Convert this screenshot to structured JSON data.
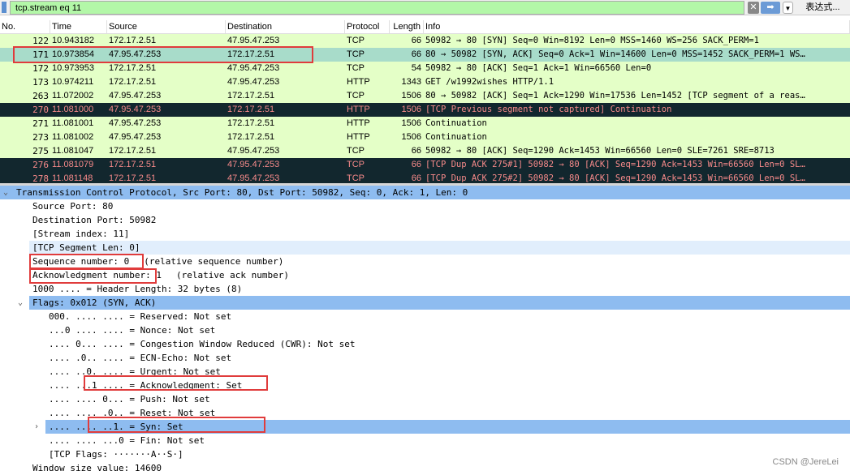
{
  "filter": {
    "value": "tcp.stream eq 11",
    "clear_icon": "x-icon",
    "apply_icon": "arrow-right-icon",
    "expression_label": "表达式..."
  },
  "columns": [
    "No.",
    "Time",
    "Source",
    "Destination",
    "Protocol",
    "Length",
    "Info"
  ],
  "packets": [
    {
      "no": "122",
      "time": "10.943182",
      "src": "172.17.2.51",
      "dst": "47.95.47.253",
      "proto": "TCP",
      "len": "66",
      "info": "50982 → 80 [SYN] Seq=0 Win=8192 Len=0 MSS=1460 WS=256 SACK_PERM=1",
      "style": "g"
    },
    {
      "no": "171",
      "time": "10.973854",
      "src": "47.95.47.253",
      "dst": "172.17.2.51",
      "proto": "TCP",
      "len": "66",
      "info": "80 → 50982 [SYN, ACK] Seq=0 Ack=1 Win=14600 Len=0 MSS=1452 SACK_PERM=1 WS…",
      "style": "sel"
    },
    {
      "no": "172",
      "time": "10.973953",
      "src": "172.17.2.51",
      "dst": "47.95.47.253",
      "proto": "TCP",
      "len": "54",
      "info": "50982 → 80 [ACK] Seq=1 Ack=1 Win=66560 Len=0",
      "style": "g"
    },
    {
      "no": "173",
      "time": "10.974211",
      "src": "172.17.2.51",
      "dst": "47.95.47.253",
      "proto": "HTTP",
      "len": "1343",
      "info": "GET /w1992wishes HTTP/1.1",
      "style": "g"
    },
    {
      "no": "263",
      "time": "11.072002",
      "src": "47.95.47.253",
      "dst": "172.17.2.51",
      "proto": "TCP",
      "len": "1506",
      "info": "80 → 50982 [ACK] Seq=1 Ack=1290 Win=17536 Len=1452 [TCP segment of a reas…",
      "style": "g"
    },
    {
      "no": "270",
      "time": "11.081000",
      "src": "47.95.47.253",
      "dst": "172.17.2.51",
      "proto": "HTTP",
      "len": "1506",
      "info": "[TCP Previous segment not captured] Continuation",
      "style": "dk"
    },
    {
      "no": "271",
      "time": "11.081001",
      "src": "47.95.47.253",
      "dst": "172.17.2.51",
      "proto": "HTTP",
      "len": "1506",
      "info": "Continuation",
      "style": "g"
    },
    {
      "no": "273",
      "time": "11.081002",
      "src": "47.95.47.253",
      "dst": "172.17.2.51",
      "proto": "HTTP",
      "len": "1506",
      "info": "Continuation",
      "style": "g"
    },
    {
      "no": "275",
      "time": "11.081047",
      "src": "172.17.2.51",
      "dst": "47.95.47.253",
      "proto": "TCP",
      "len": "66",
      "info": "50982 → 80 [ACK] Seq=1290 Ack=1453 Win=66560 Len=0 SLE=7261 SRE=8713",
      "style": "g"
    },
    {
      "no": "276",
      "time": "11.081079",
      "src": "172.17.2.51",
      "dst": "47.95.47.253",
      "proto": "TCP",
      "len": "66",
      "info": "[TCP Dup ACK 275#1] 50982 → 80 [ACK] Seq=1290 Ack=1453 Win=66560 Len=0 SL…",
      "style": "dk"
    },
    {
      "no": "278",
      "time": "11.081148",
      "src": "172.17.2.51",
      "dst": "47.95.47.253",
      "proto": "TCP",
      "len": "66",
      "info": "[TCP Dup ACK 275#2] 50982 → 80 [ACK] Seq=1290 Ack=1453 Win=66560 Len=0 SL…",
      "style": "dk"
    }
  ],
  "details": [
    {
      "text": "Transmission Control Protocol, Src Port: 80, Dst Port: 50982, Seq: 0, Ack: 1, Len: 0",
      "level": 0,
      "style": "hl",
      "toggle": "v"
    },
    {
      "text": "Source Port: 80",
      "level": 1
    },
    {
      "text": "Destination Port: 50982",
      "level": 1
    },
    {
      "text": "[Stream index: 11]",
      "level": 1
    },
    {
      "text": "[TCP Segment Len: 0]",
      "level": 1,
      "style": "lb"
    },
    {
      "text": "Sequence number: 0",
      "suffix": "(relative sequence number)",
      "level": 1
    },
    {
      "text": "Acknowledgment number: 1",
      "suffix": "(relative ack number)",
      "level": 1
    },
    {
      "text": "1000 .... = Header Length: 32 bytes (8)",
      "level": 1
    },
    {
      "text": "Flags: 0x012 (SYN, ACK)",
      "level": 1,
      "style": "hl",
      "toggle": "v"
    },
    {
      "text": "000. .... .... = Reserved: Not set",
      "level": 2
    },
    {
      "text": "...0 .... .... = Nonce: Not set",
      "level": 2
    },
    {
      "text": ".... 0... .... = Congestion Window Reduced (CWR): Not set",
      "level": 2
    },
    {
      "text": ".... .0.. .... = ECN-Echo: Not set",
      "level": 2
    },
    {
      "text": ".... ..0. .... = Urgent: Not set",
      "level": 2
    },
    {
      "text": ".... ...1 .... = Acknowledgment: Set",
      "level": 2
    },
    {
      "text": ".... .... 0... = Push: Not set",
      "level": 2
    },
    {
      "text": ".... .... .0.. = Reset: Not set",
      "level": 2
    },
    {
      "text": ".... .... ..1. = Syn: Set",
      "level": 2,
      "style": "hl",
      "toggle": ">"
    },
    {
      "text": ".... .... ...0 = Fin: Not set",
      "level": 2
    },
    {
      "text": "[TCP Flags: ·······A··S·]",
      "level": 2
    },
    {
      "text": "Window size value: 14600",
      "level": 1
    }
  ],
  "colors": {
    "green_row": "#e4ffc7",
    "selected_row": "#a8dcca",
    "dark_row": "#12272e",
    "dark_text": "#f78a8a",
    "highlight": "#8ebcf0",
    "annotation": "#e03c3c"
  },
  "watermark": "CSDN @JereLei"
}
